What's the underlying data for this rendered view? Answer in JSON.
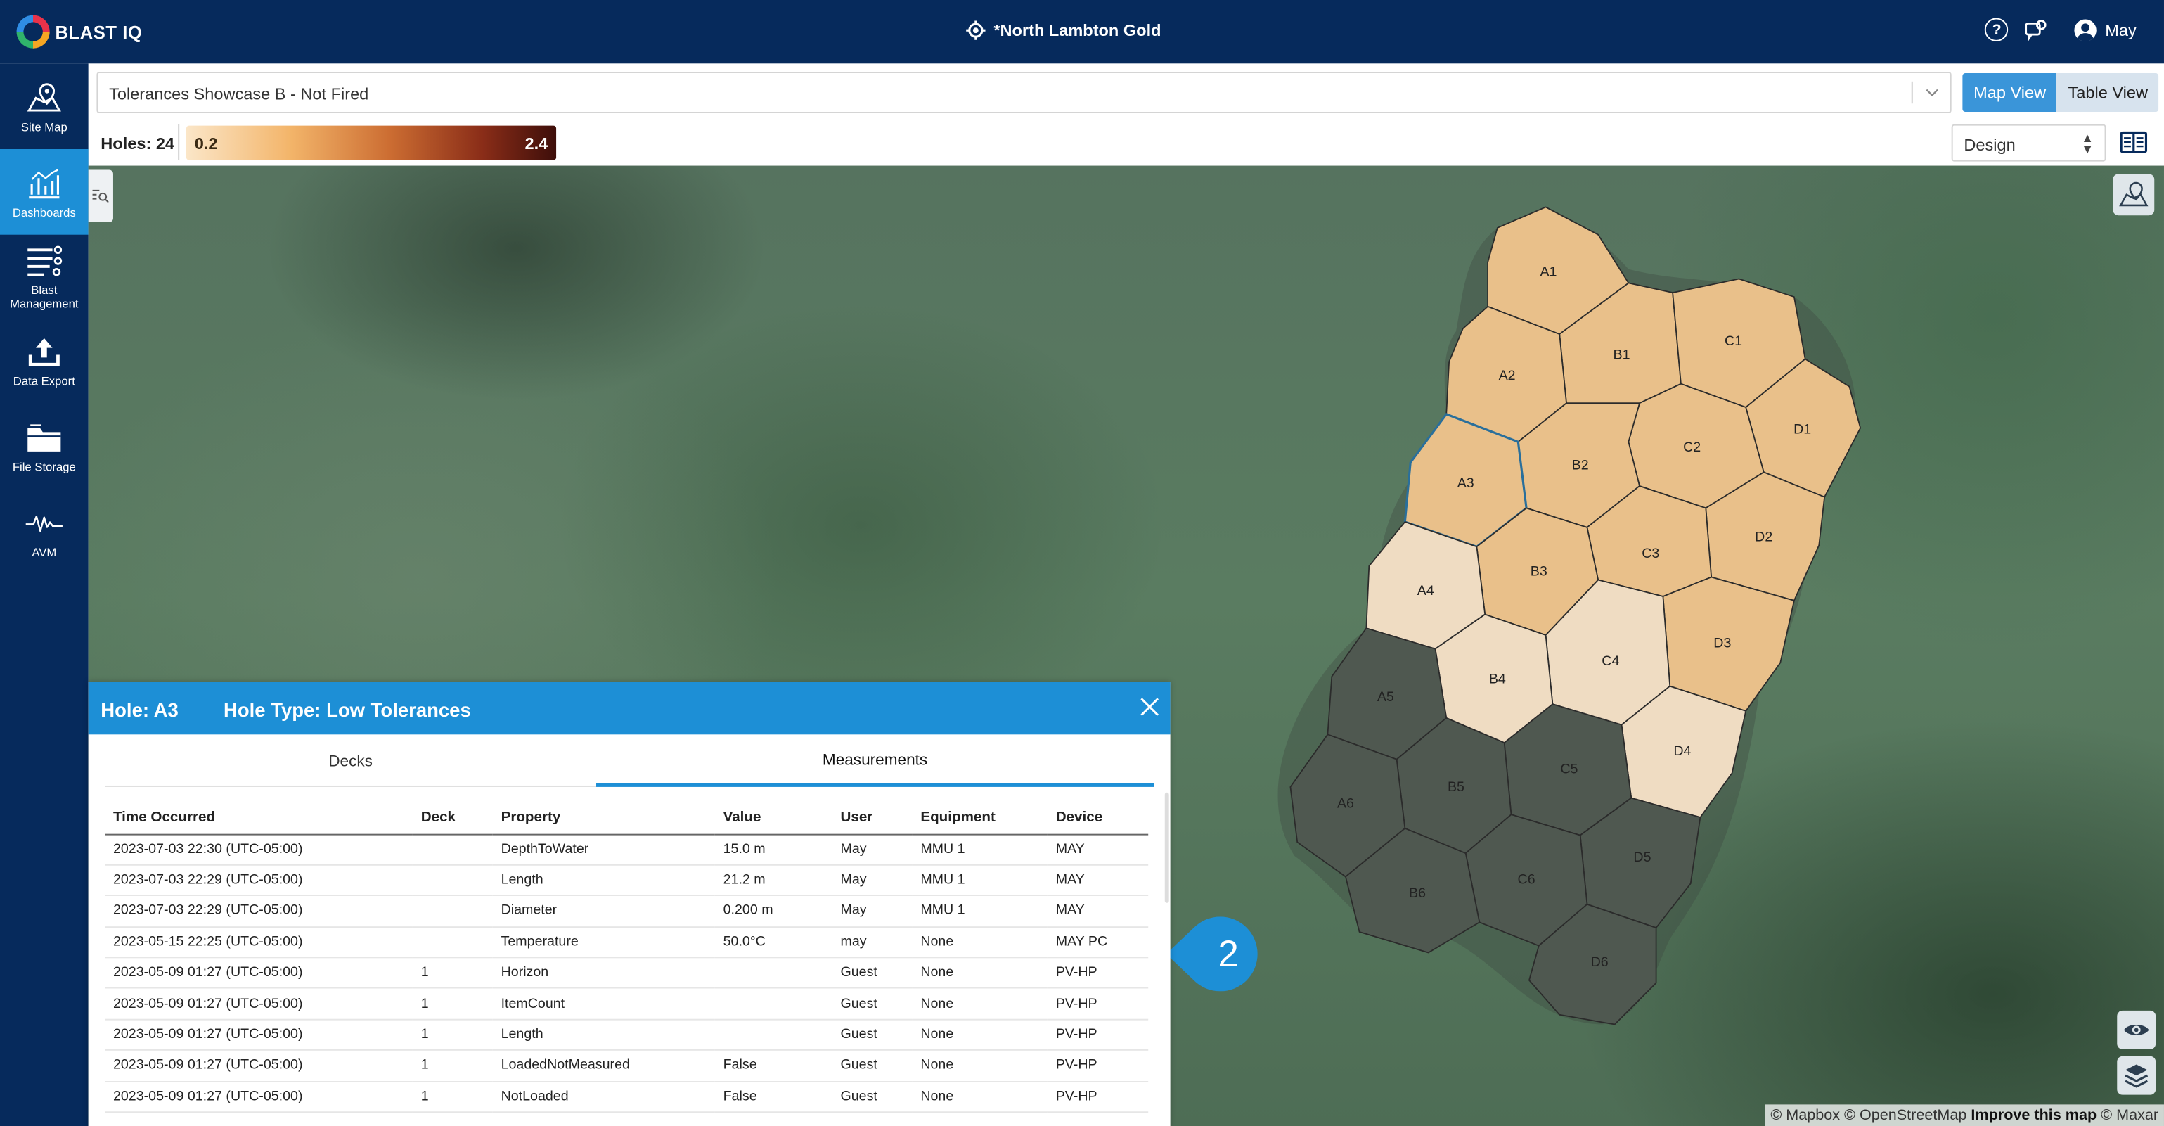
{
  "header": {
    "brand": "BLAST IQ",
    "site": "*North Lambton Gold",
    "user": "May"
  },
  "sidebar": {
    "items": [
      {
        "label": "Site Map",
        "icon": "map-pin-icon"
      },
      {
        "label": "Dashboards",
        "icon": "dashboard-chart-icon",
        "active": true
      },
      {
        "label": "Blast Management",
        "icon": "list-settings-icon"
      },
      {
        "label": "Data Export",
        "icon": "upload-icon"
      },
      {
        "label": "File Storage",
        "icon": "folder-icon"
      },
      {
        "label": "AVM",
        "icon": "waveform-icon"
      }
    ]
  },
  "toolbar": {
    "blast_select": "Tolerances Showcase B - Not Fired",
    "map_view": "Map View",
    "table_view": "Table View",
    "holes": "Holes: 24",
    "legend_min": "0.2",
    "legend_max": "2.4",
    "design_select": "Design"
  },
  "map": {
    "attribution": "© Mapbox © OpenStreetMap",
    "attribution_bold": "Improve this map",
    "attribution_tail": "© Maxar",
    "holes": [
      {
        "id": "A1",
        "level": "medium"
      },
      {
        "id": "B1",
        "level": "medium"
      },
      {
        "id": "C1",
        "level": "medium"
      },
      {
        "id": "A2",
        "level": "medium"
      },
      {
        "id": "D1",
        "level": "medium"
      },
      {
        "id": "C2",
        "level": "medium"
      },
      {
        "id": "B2",
        "level": "medium"
      },
      {
        "id": "A3",
        "level": "medium",
        "selected": true
      },
      {
        "id": "D2",
        "level": "medium"
      },
      {
        "id": "C3",
        "level": "medium"
      },
      {
        "id": "B3",
        "level": "medium"
      },
      {
        "id": "A4",
        "level": "low"
      },
      {
        "id": "D3",
        "level": "medium"
      },
      {
        "id": "C4",
        "level": "low"
      },
      {
        "id": "B4",
        "level": "low"
      },
      {
        "id": "A5",
        "level": "none"
      },
      {
        "id": "D4",
        "level": "low"
      },
      {
        "id": "C5",
        "level": "none"
      },
      {
        "id": "B5",
        "level": "none"
      },
      {
        "id": "A6",
        "level": "none"
      },
      {
        "id": "D5",
        "level": "none"
      },
      {
        "id": "C6",
        "level": "none"
      },
      {
        "id": "B6",
        "level": "none"
      },
      {
        "id": "D6",
        "level": "none"
      }
    ],
    "colors": {
      "medium": "#e9c08a",
      "low": "#efdcc2",
      "none": "#4f5850",
      "selected_border": "#2a6f9b"
    }
  },
  "callout": {
    "number": "2",
    "color": "#1d8fd6"
  },
  "panel": {
    "hole": "Hole: A3",
    "hole_type": "Hole Type: Low Tolerances",
    "tabs": [
      "Decks",
      "Measurements"
    ],
    "active_tab": "Measurements",
    "columns": [
      "Time Occurred",
      "Deck",
      "Property",
      "Value",
      "User",
      "Equipment",
      "Device"
    ],
    "rows": [
      [
        "2023-07-03 22:30 (UTC-05:00)",
        "",
        "DepthToWater",
        "15.0 m",
        "May",
        "MMU 1",
        "MAY"
      ],
      [
        "2023-07-03 22:29 (UTC-05:00)",
        "",
        "Length",
        "21.2 m",
        "May",
        "MMU 1",
        "MAY"
      ],
      [
        "2023-07-03 22:29 (UTC-05:00)",
        "",
        "Diameter",
        "0.200 m",
        "May",
        "MMU 1",
        "MAY"
      ],
      [
        "2023-05-15 22:25 (UTC-05:00)",
        "",
        "Temperature",
        "50.0°C",
        "may",
        "None",
        "MAY PC"
      ],
      [
        "2023-05-09 01:27 (UTC-05:00)",
        "1",
        "Horizon",
        "",
        "Guest",
        "None",
        "PV-HP"
      ],
      [
        "2023-05-09 01:27 (UTC-05:00)",
        "1",
        "ItemCount",
        "",
        "Guest",
        "None",
        "PV-HP"
      ],
      [
        "2023-05-09 01:27 (UTC-05:00)",
        "1",
        "Length",
        "",
        "Guest",
        "None",
        "PV-HP"
      ],
      [
        "2023-05-09 01:27 (UTC-05:00)",
        "1",
        "LoadedNotMeasured",
        "False",
        "Guest",
        "None",
        "PV-HP"
      ],
      [
        "2023-05-09 01:27 (UTC-05:00)",
        "1",
        "NotLoaded",
        "False",
        "Guest",
        "None",
        "PV-HP"
      ]
    ]
  }
}
